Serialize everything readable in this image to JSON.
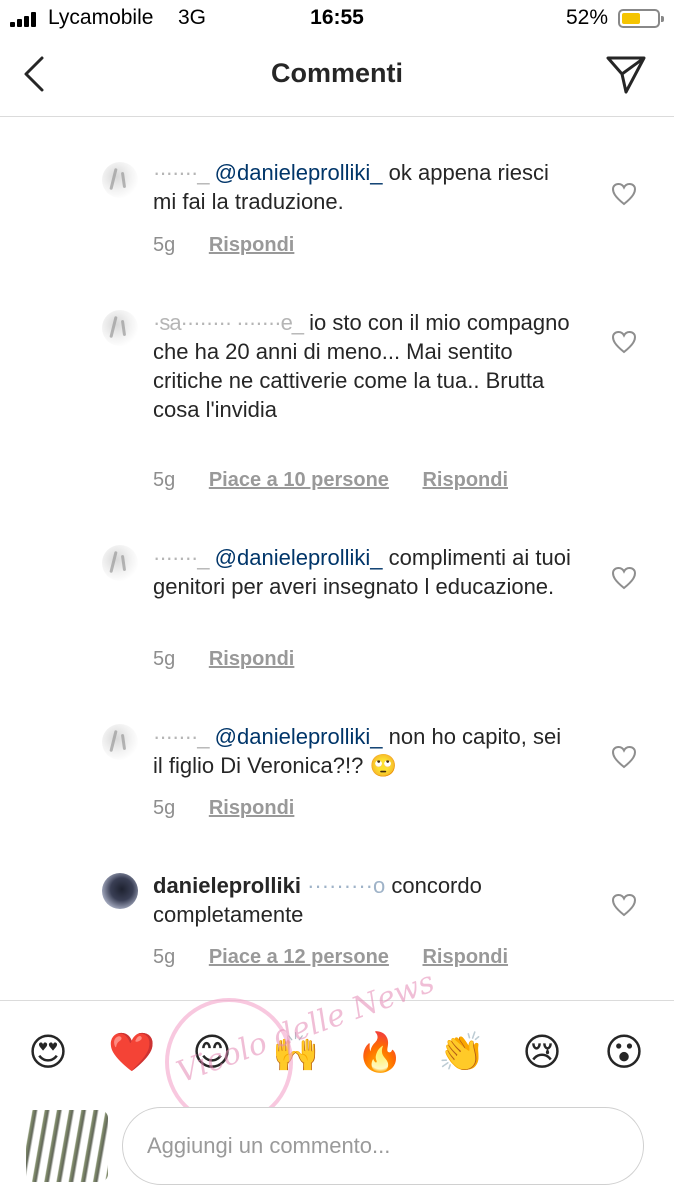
{
  "status": {
    "carrier": "Lycamobile",
    "network": "3G",
    "time": "16:55",
    "battery": "52%",
    "battery_level": 0.52
  },
  "header": {
    "title": "Commenti",
    "back_icon": "chevron-left-icon",
    "direct_icon": "paper-plane-icon"
  },
  "comments": [
    {
      "user": "·······_",
      "mention": "@danieleprolliki_",
      "body": " ok appena riesci mi fai la traduzione.",
      "age": "5g",
      "likes": "",
      "reply": "Rispondi"
    },
    {
      "user": "·sa········ ·······e_",
      "mention": "",
      "body": " io sto con il mio compagno che ha 20 anni di meno... Mai sentito critiche ne cattiverie come la tua.. Brutta cosa l'invidia",
      "age": "5g",
      "likes": "Piace a 10 persone",
      "reply": "Rispondi"
    },
    {
      "user": "·······_",
      "mention": "@danieleprolliki_",
      "body": " complimenti ai tuoi genitori per averi insegnato l educazione.",
      "age": "5g",
      "likes": "",
      "reply": "Rispondi"
    },
    {
      "user": "·······_",
      "mention": "@danieleprolliki_",
      "body": " non ho capito, sei il figlio Di Veronica?!? 🙄",
      "age": "5g",
      "likes": "",
      "reply": "Rispondi"
    },
    {
      "user": "danieleprolliki",
      "mention": "·········o",
      "body": " concordo completamente",
      "age": "5g",
      "likes": "Piace a 12 persone",
      "reply": "Rispondi"
    }
  ],
  "emoji_bar": [
    "😍",
    "❤️",
    "😊",
    "🙌",
    "🔥",
    "👏",
    "😢",
    "😮"
  ],
  "input": {
    "placeholder": "Aggiungi un commento..."
  },
  "watermark": {
    "text": "Vicolo delle News"
  },
  "colors": {
    "mention": "#003569",
    "meta": "#8e8e8e",
    "battery": "#f5c400",
    "divider": "#dbdbdb"
  }
}
